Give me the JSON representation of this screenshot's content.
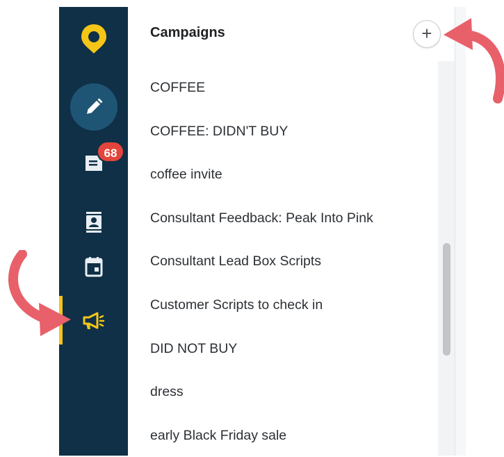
{
  "nav": {
    "items": [
      {
        "icon": "location-pin-logo-icon",
        "label": ""
      },
      {
        "icon": "pencil-icon",
        "label": ""
      },
      {
        "icon": "inbox-icon",
        "label": ""
      },
      {
        "icon": "contacts-icon",
        "label": ""
      },
      {
        "icon": "calendar-icon",
        "label": ""
      },
      {
        "icon": "megaphone-icon",
        "label": ""
      }
    ],
    "inbox_badge": "68"
  },
  "panel": {
    "title": "Campaigns",
    "add_label": "+",
    "campaigns": [
      "COFFEE",
      "COFFEE: DIDN'T BUY",
      "coffee invite",
      "Consultant Feedback: Peak Into Pink",
      "Consultant Lead Box Scripts",
      "Customer Scripts to check in",
      "DID NOT BUY",
      "dress",
      "early Black Friday sale"
    ]
  },
  "colors": {
    "rail": "#0f3047",
    "accent_yellow": "#f5c518",
    "badge_red": "#e2453c",
    "arrow_coral": "#e8606a"
  }
}
